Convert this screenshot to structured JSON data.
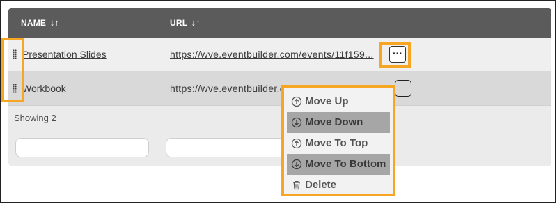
{
  "table": {
    "columns": [
      {
        "label": "NAME",
        "sort_icon": "sort-arrows-icon",
        "sort_glyph": "↓↑"
      },
      {
        "label": "URL",
        "sort_icon": "sort-arrows-icon",
        "sort_glyph": "↓↑"
      }
    ],
    "rows": [
      {
        "name": "Presentation Slides",
        "url": "https://wve.eventbuilder.com/events/11f159..."
      },
      {
        "name": "Workbook",
        "url": "https://wve.eventbuilder.com/events/11f15..."
      }
    ],
    "more_glyph": "···",
    "showing": "Showing 2"
  },
  "menu": {
    "items": [
      {
        "label": "Move Up",
        "icon": "circle-arrow-up-icon"
      },
      {
        "label": "Move Down",
        "icon": "circle-arrow-down-icon"
      },
      {
        "label": "Move To Top",
        "icon": "circle-arrow-up-icon"
      },
      {
        "label": "Move To Bottom",
        "icon": "circle-arrow-down-icon"
      },
      {
        "label": "Delete",
        "icon": "trash-icon"
      }
    ],
    "active_items": [
      "Move Down",
      "Move To Bottom"
    ]
  },
  "colors": {
    "header_bg": "#5b5b5b",
    "highlight": "#f6a623",
    "row_alt": "#d9d9d9",
    "menu_active": "#a6a6a6"
  }
}
